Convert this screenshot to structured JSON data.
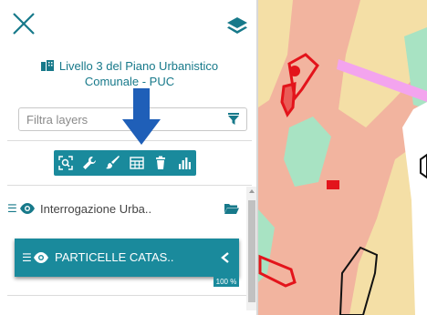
{
  "panel": {
    "title_line1": "Livello 3 del Piano Urbanistico",
    "title_line2": "Comunale - PUC"
  },
  "filter": {
    "placeholder": "Filtra layers"
  },
  "toolbar": {
    "buttons": [
      "zoom-extent-icon",
      "wrench-icon",
      "paint-brush-icon",
      "table-icon",
      "trash-icon",
      "bar-chart-icon"
    ]
  },
  "layers": [
    {
      "label": "Interrogazione Urba..",
      "visible": true
    },
    {
      "label": "PARTICELLE CATAS..",
      "visible": true,
      "opacity": "100 %"
    }
  ],
  "colors": {
    "accent": "#1a8a9c",
    "arrow": "#1f5fb8",
    "map_pink": "#f2b49f",
    "map_beige": "#f4dfa6",
    "map_green": "#a8e3c3",
    "map_magenta": "#f3a4ee",
    "parcel_red": "#e3141b"
  }
}
